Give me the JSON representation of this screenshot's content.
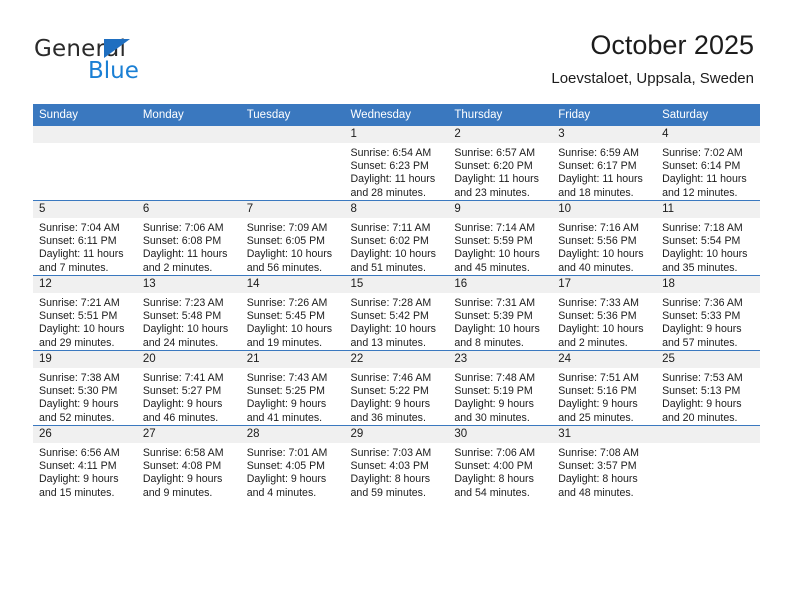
{
  "brand": {
    "name_part1": "General",
    "name_part2": "Blue",
    "logo_icon": "triangle-flag-icon",
    "accent_color": "#1a7fd4"
  },
  "header": {
    "title": "October 2025",
    "subtitle": "Loevstaloet, Uppsala, Sweden"
  },
  "calendar": {
    "header_bg": "#3a78bf",
    "daynum_bg": "#f0f0f0",
    "weekday_headers": [
      "Sunday",
      "Monday",
      "Tuesday",
      "Wednesday",
      "Thursday",
      "Friday",
      "Saturday"
    ],
    "weeks": [
      [
        {
          "day": "",
          "sunrise": "",
          "sunset": "",
          "daylight_line1": "",
          "daylight_line2": ""
        },
        {
          "day": "",
          "sunrise": "",
          "sunset": "",
          "daylight_line1": "",
          "daylight_line2": ""
        },
        {
          "day": "",
          "sunrise": "",
          "sunset": "",
          "daylight_line1": "",
          "daylight_line2": ""
        },
        {
          "day": "1",
          "sunrise": "Sunrise: 6:54 AM",
          "sunset": "Sunset: 6:23 PM",
          "daylight_line1": "Daylight: 11 hours",
          "daylight_line2": "and 28 minutes."
        },
        {
          "day": "2",
          "sunrise": "Sunrise: 6:57 AM",
          "sunset": "Sunset: 6:20 PM",
          "daylight_line1": "Daylight: 11 hours",
          "daylight_line2": "and 23 minutes."
        },
        {
          "day": "3",
          "sunrise": "Sunrise: 6:59 AM",
          "sunset": "Sunset: 6:17 PM",
          "daylight_line1": "Daylight: 11 hours",
          "daylight_line2": "and 18 minutes."
        },
        {
          "day": "4",
          "sunrise": "Sunrise: 7:02 AM",
          "sunset": "Sunset: 6:14 PM",
          "daylight_line1": "Daylight: 11 hours",
          "daylight_line2": "and 12 minutes."
        }
      ],
      [
        {
          "day": "5",
          "sunrise": "Sunrise: 7:04 AM",
          "sunset": "Sunset: 6:11 PM",
          "daylight_line1": "Daylight: 11 hours",
          "daylight_line2": "and 7 minutes."
        },
        {
          "day": "6",
          "sunrise": "Sunrise: 7:06 AM",
          "sunset": "Sunset: 6:08 PM",
          "daylight_line1": "Daylight: 11 hours",
          "daylight_line2": "and 2 minutes."
        },
        {
          "day": "7",
          "sunrise": "Sunrise: 7:09 AM",
          "sunset": "Sunset: 6:05 PM",
          "daylight_line1": "Daylight: 10 hours",
          "daylight_line2": "and 56 minutes."
        },
        {
          "day": "8",
          "sunrise": "Sunrise: 7:11 AM",
          "sunset": "Sunset: 6:02 PM",
          "daylight_line1": "Daylight: 10 hours",
          "daylight_line2": "and 51 minutes."
        },
        {
          "day": "9",
          "sunrise": "Sunrise: 7:14 AM",
          "sunset": "Sunset: 5:59 PM",
          "daylight_line1": "Daylight: 10 hours",
          "daylight_line2": "and 45 minutes."
        },
        {
          "day": "10",
          "sunrise": "Sunrise: 7:16 AM",
          "sunset": "Sunset: 5:56 PM",
          "daylight_line1": "Daylight: 10 hours",
          "daylight_line2": "and 40 minutes."
        },
        {
          "day": "11",
          "sunrise": "Sunrise: 7:18 AM",
          "sunset": "Sunset: 5:54 PM",
          "daylight_line1": "Daylight: 10 hours",
          "daylight_line2": "and 35 minutes."
        }
      ],
      [
        {
          "day": "12",
          "sunrise": "Sunrise: 7:21 AM",
          "sunset": "Sunset: 5:51 PM",
          "daylight_line1": "Daylight: 10 hours",
          "daylight_line2": "and 29 minutes."
        },
        {
          "day": "13",
          "sunrise": "Sunrise: 7:23 AM",
          "sunset": "Sunset: 5:48 PM",
          "daylight_line1": "Daylight: 10 hours",
          "daylight_line2": "and 24 minutes."
        },
        {
          "day": "14",
          "sunrise": "Sunrise: 7:26 AM",
          "sunset": "Sunset: 5:45 PM",
          "daylight_line1": "Daylight: 10 hours",
          "daylight_line2": "and 19 minutes."
        },
        {
          "day": "15",
          "sunrise": "Sunrise: 7:28 AM",
          "sunset": "Sunset: 5:42 PM",
          "daylight_line1": "Daylight: 10 hours",
          "daylight_line2": "and 13 minutes."
        },
        {
          "day": "16",
          "sunrise": "Sunrise: 7:31 AM",
          "sunset": "Sunset: 5:39 PM",
          "daylight_line1": "Daylight: 10 hours",
          "daylight_line2": "and 8 minutes."
        },
        {
          "day": "17",
          "sunrise": "Sunrise: 7:33 AM",
          "sunset": "Sunset: 5:36 PM",
          "daylight_line1": "Daylight: 10 hours",
          "daylight_line2": "and 2 minutes."
        },
        {
          "day": "18",
          "sunrise": "Sunrise: 7:36 AM",
          "sunset": "Sunset: 5:33 PM",
          "daylight_line1": "Daylight: 9 hours",
          "daylight_line2": "and 57 minutes."
        }
      ],
      [
        {
          "day": "19",
          "sunrise": "Sunrise: 7:38 AM",
          "sunset": "Sunset: 5:30 PM",
          "daylight_line1": "Daylight: 9 hours",
          "daylight_line2": "and 52 minutes."
        },
        {
          "day": "20",
          "sunrise": "Sunrise: 7:41 AM",
          "sunset": "Sunset: 5:27 PM",
          "daylight_line1": "Daylight: 9 hours",
          "daylight_line2": "and 46 minutes."
        },
        {
          "day": "21",
          "sunrise": "Sunrise: 7:43 AM",
          "sunset": "Sunset: 5:25 PM",
          "daylight_line1": "Daylight: 9 hours",
          "daylight_line2": "and 41 minutes."
        },
        {
          "day": "22",
          "sunrise": "Sunrise: 7:46 AM",
          "sunset": "Sunset: 5:22 PM",
          "daylight_line1": "Daylight: 9 hours",
          "daylight_line2": "and 36 minutes."
        },
        {
          "day": "23",
          "sunrise": "Sunrise: 7:48 AM",
          "sunset": "Sunset: 5:19 PM",
          "daylight_line1": "Daylight: 9 hours",
          "daylight_line2": "and 30 minutes."
        },
        {
          "day": "24",
          "sunrise": "Sunrise: 7:51 AM",
          "sunset": "Sunset: 5:16 PM",
          "daylight_line1": "Daylight: 9 hours",
          "daylight_line2": "and 25 minutes."
        },
        {
          "day": "25",
          "sunrise": "Sunrise: 7:53 AM",
          "sunset": "Sunset: 5:13 PM",
          "daylight_line1": "Daylight: 9 hours",
          "daylight_line2": "and 20 minutes."
        }
      ],
      [
        {
          "day": "26",
          "sunrise": "Sunrise: 6:56 AM",
          "sunset": "Sunset: 4:11 PM",
          "daylight_line1": "Daylight: 9 hours",
          "daylight_line2": "and 15 minutes."
        },
        {
          "day": "27",
          "sunrise": "Sunrise: 6:58 AM",
          "sunset": "Sunset: 4:08 PM",
          "daylight_line1": "Daylight: 9 hours",
          "daylight_line2": "and 9 minutes."
        },
        {
          "day": "28",
          "sunrise": "Sunrise: 7:01 AM",
          "sunset": "Sunset: 4:05 PM",
          "daylight_line1": "Daylight: 9 hours",
          "daylight_line2": "and 4 minutes."
        },
        {
          "day": "29",
          "sunrise": "Sunrise: 7:03 AM",
          "sunset": "Sunset: 4:03 PM",
          "daylight_line1": "Daylight: 8 hours",
          "daylight_line2": "and 59 minutes."
        },
        {
          "day": "30",
          "sunrise": "Sunrise: 7:06 AM",
          "sunset": "Sunset: 4:00 PM",
          "daylight_line1": "Daylight: 8 hours",
          "daylight_line2": "and 54 minutes."
        },
        {
          "day": "31",
          "sunrise": "Sunrise: 7:08 AM",
          "sunset": "Sunset: 3:57 PM",
          "daylight_line1": "Daylight: 8 hours",
          "daylight_line2": "and 48 minutes."
        },
        {
          "day": "",
          "sunrise": "",
          "sunset": "",
          "daylight_line1": "",
          "daylight_line2": ""
        }
      ]
    ]
  }
}
